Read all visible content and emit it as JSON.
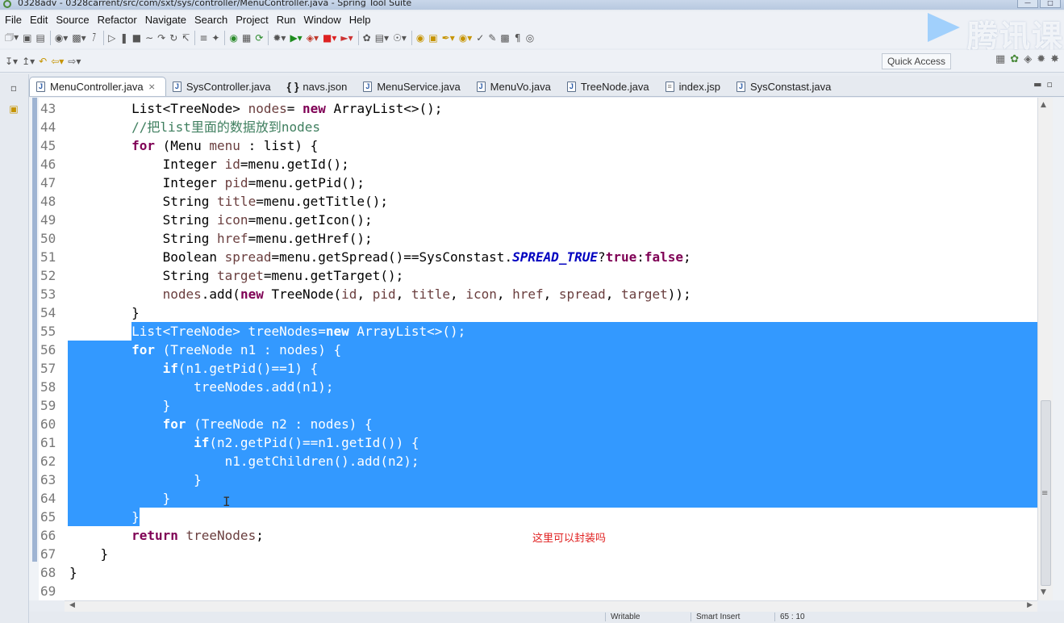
{
  "window": {
    "title": "0328adv - 0328carrent/src/com/sxt/sys/controller/MenuController.java - Spring Tool Suite"
  },
  "menu": [
    "File",
    "Edit",
    "Source",
    "Refactor",
    "Navigate",
    "Search",
    "Project",
    "Run",
    "Window",
    "Help"
  ],
  "toolbar": {
    "quick_access": "Quick Access"
  },
  "watermark": "腾讯课",
  "tabs": [
    {
      "label": "MenuController.java",
      "icon": "java-file-icon",
      "active": true
    },
    {
      "label": "SysController.java",
      "icon": "java-file-icon"
    },
    {
      "label": "navs.json",
      "icon": "json-file-icon"
    },
    {
      "label": "MenuService.java",
      "icon": "java-file-icon"
    },
    {
      "label": "MenuVo.java",
      "icon": "java-file-icon"
    },
    {
      "label": "TreeNode.java",
      "icon": "java-file-icon"
    },
    {
      "label": "index.jsp",
      "icon": "jsp-file-icon"
    },
    {
      "label": "SysConstast.java",
      "icon": "java-file-icon"
    }
  ],
  "editor": {
    "selection_start_line": 55,
    "selection_end_line": 65,
    "lines": [
      {
        "num": "43",
        "segments": [
          [
            "",
            "        List<TreeNode> "
          ],
          [
            "fld",
            "nodes"
          ],
          [
            "",
            "= "
          ],
          [
            "kw",
            "new"
          ],
          [
            "",
            " ArrayList<>();"
          ]
        ]
      },
      {
        "num": "44",
        "segments": [
          [
            "cmt",
            "        //把list里面的数据放到nodes"
          ]
        ]
      },
      {
        "num": "45",
        "segments": [
          [
            "",
            "        "
          ],
          [
            "kw",
            "for"
          ],
          [
            "",
            " (Menu "
          ],
          [
            "fld",
            "menu"
          ],
          [
            "",
            " : list) {"
          ]
        ]
      },
      {
        "num": "46",
        "segments": [
          [
            "",
            "            Integer "
          ],
          [
            "fld",
            "id"
          ],
          [
            "",
            "=menu.getId();"
          ]
        ]
      },
      {
        "num": "47",
        "segments": [
          [
            "",
            "            Integer "
          ],
          [
            "fld",
            "pid"
          ],
          [
            "",
            "=menu.getPid();"
          ]
        ]
      },
      {
        "num": "48",
        "segments": [
          [
            "",
            "            String "
          ],
          [
            "fld",
            "title"
          ],
          [
            "",
            "=menu.getTitle();"
          ]
        ]
      },
      {
        "num": "49",
        "segments": [
          [
            "",
            "            String "
          ],
          [
            "fld",
            "icon"
          ],
          [
            "",
            "=menu.getIcon();"
          ]
        ]
      },
      {
        "num": "50",
        "segments": [
          [
            "",
            "            String "
          ],
          [
            "fld",
            "href"
          ],
          [
            "",
            "=menu.getHref();"
          ]
        ]
      },
      {
        "num": "51",
        "segments": [
          [
            "",
            "            Boolean "
          ],
          [
            "fld",
            "spread"
          ],
          [
            "",
            "=menu.getSpread()==SysConstast."
          ],
          [
            "cst",
            "SPREAD_TRUE"
          ],
          [
            "",
            "?"
          ],
          [
            "kw",
            "true"
          ],
          [
            "",
            ":"
          ],
          [
            "kw",
            "false"
          ],
          [
            "",
            ";"
          ]
        ]
      },
      {
        "num": "52",
        "segments": [
          [
            "",
            "            String "
          ],
          [
            "fld",
            "target"
          ],
          [
            "",
            "=menu.getTarget();"
          ]
        ]
      },
      {
        "num": "53",
        "segments": [
          [
            "",
            "            "
          ],
          [
            "fld",
            "nodes"
          ],
          [
            "",
            ".add("
          ],
          [
            "kw",
            "new"
          ],
          [
            "",
            " TreeNode("
          ],
          [
            "fld",
            "id"
          ],
          [
            "",
            ", "
          ],
          [
            "fld",
            "pid"
          ],
          [
            "",
            ", "
          ],
          [
            "fld",
            "title"
          ],
          [
            "",
            ", "
          ],
          [
            "fld",
            "icon"
          ],
          [
            "",
            ", "
          ],
          [
            "fld",
            "href"
          ],
          [
            "",
            ", "
          ],
          [
            "fld",
            "spread"
          ],
          [
            "",
            ", "
          ],
          [
            "fld",
            "target"
          ],
          [
            "",
            "));"
          ]
        ]
      },
      {
        "num": "54",
        "segments": [
          [
            "",
            "        }"
          ]
        ]
      },
      {
        "num": "55",
        "segments": [
          [
            "",
            "        List<TreeNode> treeNodes="
          ],
          [
            "kw",
            "new"
          ],
          [
            "",
            " ArrayList<>();"
          ]
        ]
      },
      {
        "num": "56",
        "segments": [
          [
            "",
            "        "
          ],
          [
            "kw",
            "for"
          ],
          [
            "",
            " (TreeNode n1 : nodes) {"
          ]
        ]
      },
      {
        "num": "57",
        "segments": [
          [
            "",
            "            "
          ],
          [
            "kw",
            "if"
          ],
          [
            "",
            "(n1.getPid()==1) {"
          ]
        ]
      },
      {
        "num": "58",
        "segments": [
          [
            "",
            "                treeNodes.add(n1);"
          ]
        ]
      },
      {
        "num": "59",
        "segments": [
          [
            "",
            "            }"
          ]
        ]
      },
      {
        "num": "60",
        "segments": [
          [
            "",
            "            "
          ],
          [
            "kw",
            "for"
          ],
          [
            "",
            " (TreeNode n2 : nodes) {"
          ]
        ]
      },
      {
        "num": "61",
        "segments": [
          [
            "",
            "                "
          ],
          [
            "kw",
            "if"
          ],
          [
            "",
            "(n2.getPid()==n1.getId()) {"
          ]
        ]
      },
      {
        "num": "62",
        "segments": [
          [
            "",
            "                    n1.getChildren().add(n2);"
          ]
        ]
      },
      {
        "num": "63",
        "segments": [
          [
            "",
            "                }"
          ]
        ]
      },
      {
        "num": "64",
        "segments": [
          [
            "",
            "            }"
          ]
        ]
      },
      {
        "num": "65",
        "segments": [
          [
            "",
            "        }"
          ]
        ]
      },
      {
        "num": "66",
        "segments": [
          [
            "",
            "        "
          ],
          [
            "kw",
            "return"
          ],
          [
            "",
            " "
          ],
          [
            "fld",
            "treeNodes"
          ],
          [
            "",
            ";"
          ]
        ]
      },
      {
        "num": "67",
        "segments": [
          [
            "",
            "    }"
          ]
        ]
      },
      {
        "num": "68",
        "segments": [
          [
            "",
            "}"
          ]
        ]
      },
      {
        "num": "69",
        "segments": [
          [
            "",
            ""
          ]
        ]
      }
    ]
  },
  "note": "这里可以封装吗",
  "statusbar": [
    "Writable",
    "Smart Insert",
    "65 : 10"
  ]
}
